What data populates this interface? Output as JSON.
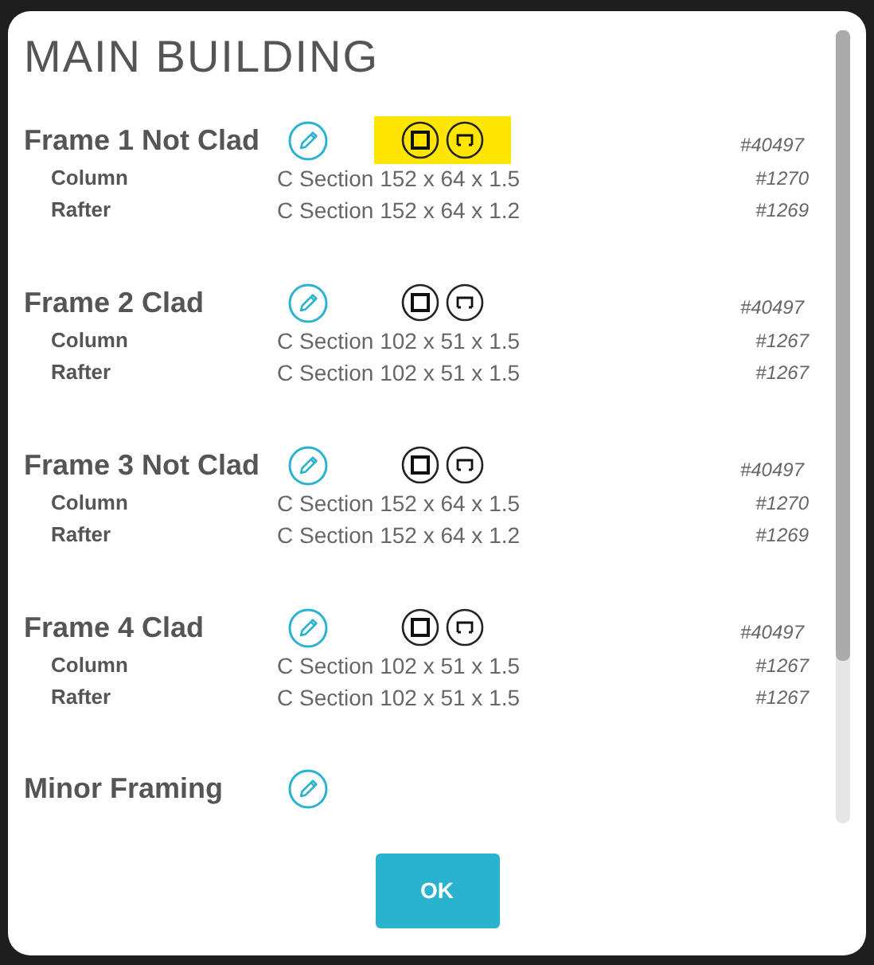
{
  "title": "MAIN BUILDING",
  "frames": [
    {
      "name": "Frame 1 Not Clad",
      "highlighted": true,
      "id": "#40497",
      "members": [
        {
          "role": "Column",
          "section": "C Section 152 x 64 x 1.5",
          "id": "#1270"
        },
        {
          "role": "Rafter",
          "section": "C Section 152 x 64 x 1.2",
          "id": "#1269"
        }
      ]
    },
    {
      "name": "Frame 2 Clad",
      "highlighted": false,
      "id": "#40497",
      "members": [
        {
          "role": "Column",
          "section": "C Section 102 x 51 x 1.5",
          "id": "#1267"
        },
        {
          "role": "Rafter",
          "section": "C Section 102 x 51 x 1.5",
          "id": "#1267"
        }
      ]
    },
    {
      "name": "Frame 3 Not Clad",
      "highlighted": false,
      "id": "#40497",
      "members": [
        {
          "role": "Column",
          "section": "C Section 152 x 64 x 1.5",
          "id": "#1270"
        },
        {
          "role": "Rafter",
          "section": "C Section 152 x 64 x 1.2",
          "id": "#1269"
        }
      ]
    },
    {
      "name": "Frame 4 Clad",
      "highlighted": false,
      "id": "#40497",
      "members": [
        {
          "role": "Column",
          "section": "C Section 102 x 51 x 1.5",
          "id": "#1267"
        },
        {
          "role": "Rafter",
          "section": "C Section 102 x 51 x 1.5",
          "id": "#1267"
        }
      ]
    }
  ],
  "minor_framing": {
    "name": "Minor Framing"
  },
  "button": "OK"
}
